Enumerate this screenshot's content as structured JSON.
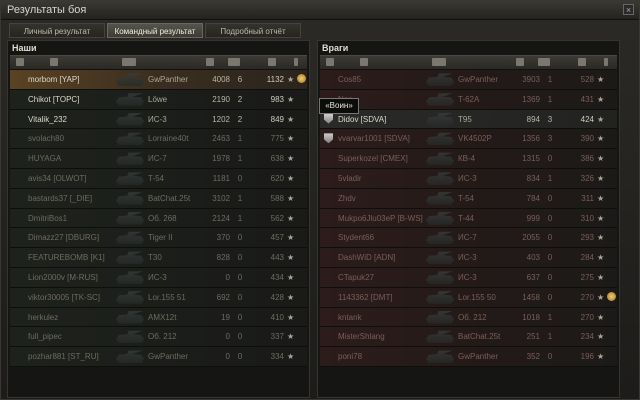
{
  "window": {
    "title": "Результаты боя"
  },
  "tabs": [
    {
      "label": "Личный результат",
      "active": false
    },
    {
      "label": "Командный результат",
      "active": true
    },
    {
      "label": "Подробный отчёт",
      "active": false
    }
  ],
  "tooltip": "«Воин»",
  "allies": {
    "title": "Наши",
    "rows": [
      {
        "name": "morbom [YAP]",
        "tank": "GwPanther",
        "xp": "4008",
        "kills": "6",
        "score": "1132",
        "state": "self",
        "medal": true
      },
      {
        "name": "Chikot [TOPC]",
        "tank": "Löwe",
        "xp": "2190",
        "kills": "2",
        "score": "983",
        "state": "alive"
      },
      {
        "name": "Vitalik_232",
        "tank": "ИС-3",
        "xp": "1202",
        "kills": "2",
        "score": "849",
        "state": "alive"
      },
      {
        "name": "svolach80",
        "tank": "Lorraine40t",
        "xp": "2463",
        "kills": "1",
        "score": "775",
        "state": "dead"
      },
      {
        "name": "HUYAGA",
        "tank": "ИС-7",
        "xp": "1978",
        "kills": "1",
        "score": "638",
        "state": "dead"
      },
      {
        "name": "avis34 [OLWOT]",
        "tank": "T-54",
        "xp": "1181",
        "kills": "0",
        "score": "620",
        "state": "dead"
      },
      {
        "name": "bastards37 [_DIE]",
        "tank": "BatChat.25t",
        "xp": "3102",
        "kills": "1",
        "score": "588",
        "state": "dead"
      },
      {
        "name": "DmitriBos1",
        "tank": "Об. 268",
        "xp": "2124",
        "kills": "1",
        "score": "562",
        "state": "dead"
      },
      {
        "name": "Dimazz27 [DBURG]",
        "tank": "Tiger II",
        "xp": "370",
        "kills": "0",
        "score": "457",
        "state": "dead"
      },
      {
        "name": "FEATUREBOMB [K1]",
        "tank": "T30",
        "xp": "828",
        "kills": "0",
        "score": "443",
        "state": "dead"
      },
      {
        "name": "Lion2000v [M-RUS]",
        "tank": "ИС-3",
        "xp": "0",
        "kills": "0",
        "score": "434",
        "state": "dead"
      },
      {
        "name": "viktor30005 [TK-SC]",
        "tank": "Lor.155 51",
        "xp": "692",
        "kills": "0",
        "score": "428",
        "state": "dead"
      },
      {
        "name": "herkulez",
        "tank": "AMX12t",
        "xp": "19",
        "kills": "0",
        "score": "410",
        "state": "dead"
      },
      {
        "name": "full_pipec",
        "tank": "Об. 212",
        "xp": "0",
        "kills": "0",
        "score": "337",
        "state": "dead"
      },
      {
        "name": "pozhar881 [ST_RU]",
        "tank": "GwPanther",
        "xp": "0",
        "kills": "0",
        "score": "334",
        "state": "dead"
      }
    ]
  },
  "enemies": {
    "title": "Враги",
    "rows": [
      {
        "name": "Cos85",
        "tank": "GwPanther",
        "xp": "3903",
        "kills": "1",
        "score": "528",
        "state": "dead"
      },
      {
        "name": "Non_",
        "tank": "T-62A",
        "xp": "1369",
        "kills": "1",
        "score": "431",
        "state": "dead"
      },
      {
        "name": "Didov [SDVA]",
        "tank": "T95",
        "xp": "894",
        "kills": "3",
        "score": "424",
        "state": "hl",
        "platoon": true
      },
      {
        "name": "vvarvar1001 [SDVA]",
        "tank": "VK4502P",
        "xp": "1356",
        "kills": "3",
        "score": "390",
        "state": "dead",
        "platoon": true
      },
      {
        "name": "Superkozel [CMEX]",
        "tank": "КВ-4",
        "xp": "1315",
        "kills": "0",
        "score": "386",
        "state": "dead"
      },
      {
        "name": "5vladir",
        "tank": "ИС-3",
        "xp": "834",
        "kills": "1",
        "score": "326",
        "state": "dead"
      },
      {
        "name": "Zhdv",
        "tank": "T-54",
        "xp": "784",
        "kills": "0",
        "score": "311",
        "state": "dead"
      },
      {
        "name": "Mukpo6Jlu03eP [B-WS]",
        "tank": "T-44",
        "xp": "999",
        "kills": "0",
        "score": "310",
        "state": "dead"
      },
      {
        "name": "Stydent66",
        "tank": "ИС-7",
        "xp": "2055",
        "kills": "0",
        "score": "293",
        "state": "dead"
      },
      {
        "name": "DashWiD [ADN]",
        "tank": "ИС-3",
        "xp": "403",
        "kills": "0",
        "score": "284",
        "state": "dead"
      },
      {
        "name": "CTapuk27",
        "tank": "ИС-3",
        "xp": "637",
        "kills": "0",
        "score": "275",
        "state": "dead"
      },
      {
        "name": "1143362 [DMT]",
        "tank": "Lor.155 50",
        "xp": "1458",
        "kills": "0",
        "score": "270",
        "state": "dead",
        "medal": true
      },
      {
        "name": "kntank",
        "tank": "Об. 212",
        "xp": "1018",
        "kills": "1",
        "score": "270",
        "state": "dead"
      },
      {
        "name": "MisterShlang",
        "tank": "BatChat.25t",
        "xp": "251",
        "kills": "1",
        "score": "234",
        "state": "dead"
      },
      {
        "name": "poni78",
        "tank": "GwPanther",
        "xp": "352",
        "kills": "0",
        "score": "196",
        "state": "dead"
      }
    ]
  },
  "icons": {
    "star": "★",
    "close": "×"
  }
}
